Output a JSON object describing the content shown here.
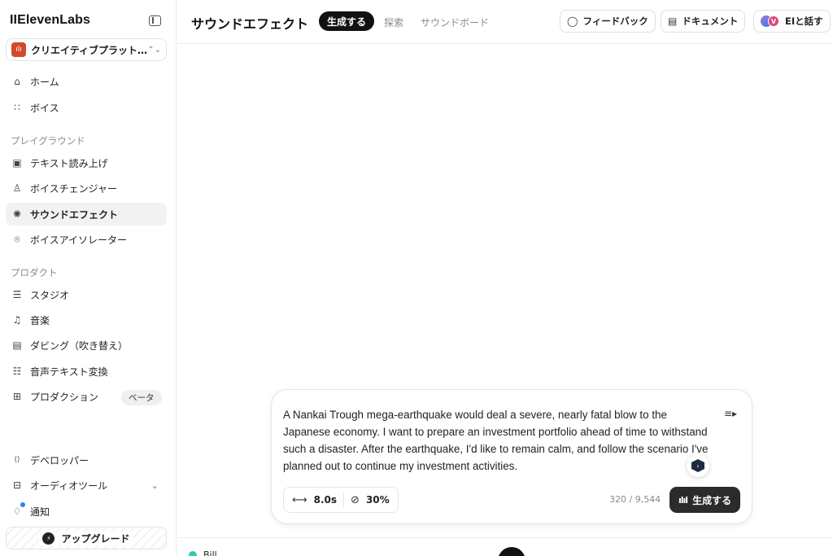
{
  "sidebar": {
    "brand": "IIElevenLabs",
    "workspace": {
      "name": "クリエイティブプラット…",
      "logo_glyph": "ılı",
      "logo_color": "#d24a2a"
    },
    "nav_top": [
      {
        "label": "ホーム",
        "icon": "home-icon",
        "glyph": "⌂"
      },
      {
        "label": "ボイス",
        "icon": "voices-icon",
        "glyph": "∷"
      }
    ],
    "section_playground": "プレイグラウンド",
    "nav_playground": [
      {
        "label": "テキスト読み上げ",
        "icon": "text-to-speech-icon",
        "glyph": "▣"
      },
      {
        "label": "ボイスチェンジャー",
        "icon": "voice-changer-icon",
        "glyph": "♙"
      },
      {
        "label": "サウンドエフェクト",
        "icon": "sound-effects-icon",
        "glyph": "✺",
        "active": true
      },
      {
        "label": "ボイスアイソレーター",
        "icon": "voice-isolator-icon",
        "glyph": "⌾"
      }
    ],
    "section_products": "プロダクト",
    "nav_products": [
      {
        "label": "スタジオ",
        "icon": "studio-icon",
        "glyph": "☰"
      },
      {
        "label": "音楽",
        "icon": "music-icon",
        "glyph": "♫"
      },
      {
        "label": "ダビング（吹き替え）",
        "icon": "dubbing-icon",
        "glyph": "▤"
      },
      {
        "label": "音声テキスト変換",
        "icon": "speech-to-text-icon",
        "glyph": "☷"
      },
      {
        "label": "プロダクション",
        "icon": "productions-icon",
        "glyph": "⊞"
      }
    ],
    "beta_label": "ベータ",
    "nav_bottom": [
      {
        "label": "デベロッパー",
        "icon": "developers-icon",
        "glyph": "⟨⟩"
      },
      {
        "label": "オーディオツール",
        "icon": "audio-tools-icon",
        "glyph": "⊟"
      },
      {
        "label": "通知",
        "icon": "bell-icon",
        "glyph": "♢"
      }
    ],
    "upgrade_label": "アップグレード"
  },
  "header": {
    "title": "サウンドエフェクト",
    "tabs": [
      "生成する",
      "探索",
      "サウンドボード"
    ],
    "feedback_label": "フィードバック",
    "docs_label": "ドキュメント",
    "talk_label": "EIと話す",
    "talk_avatar_letter": "V"
  },
  "composer": {
    "prompt": "A Nankai Trough mega-earthquake would deal a severe, nearly fatal blow to the Japanese economy. I want to prepare an investment portfolio ahead of time to withstand such a disaster. After the earthquake, I'd like to remain calm, and follow the scenario I've planned out to continue my investment activities.",
    "duration": "8.0s",
    "prompt_influence": "30%",
    "char_count": "320 / 9,544",
    "generate_label": "生成する"
  },
  "bottom": {
    "user_name": "Bill"
  }
}
